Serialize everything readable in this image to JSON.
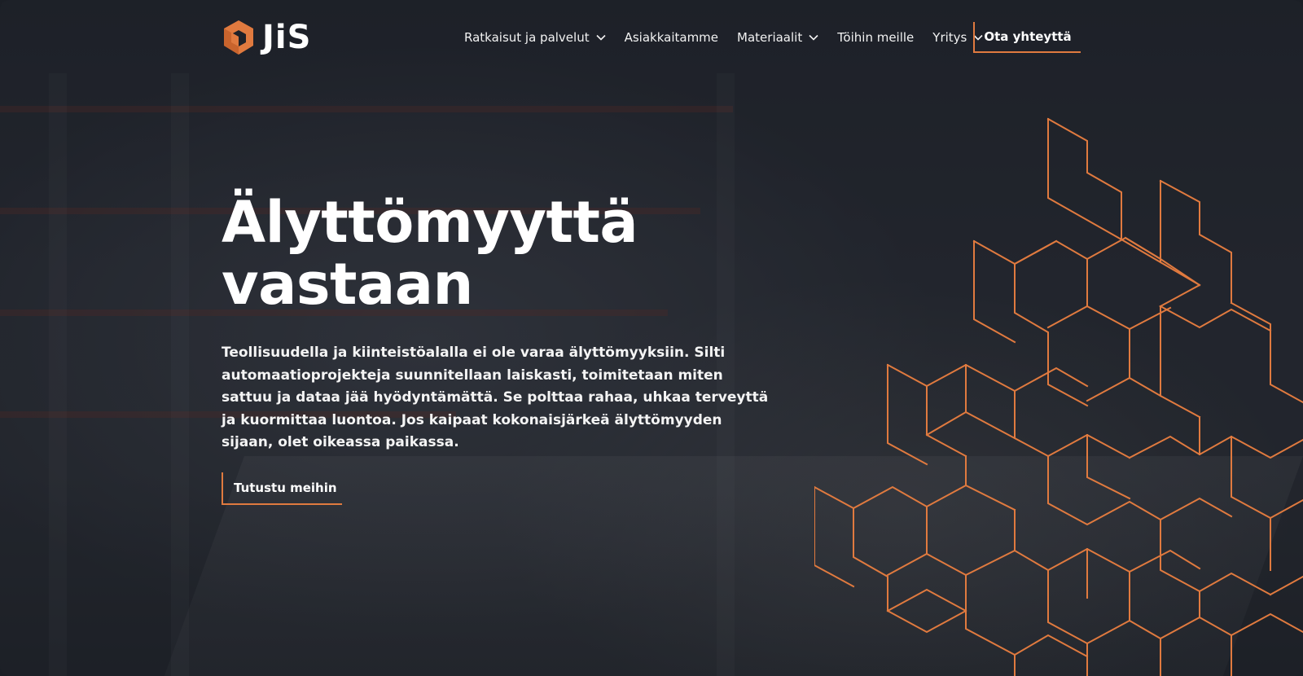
{
  "brand": {
    "logo_text": "JiS",
    "accent_color": "#e07a3f"
  },
  "nav": {
    "items": [
      {
        "label": "Ratkaisut ja palvelut",
        "has_dropdown": true
      },
      {
        "label": "Asiakkaitamme",
        "has_dropdown": false
      },
      {
        "label": "Materiaalit",
        "has_dropdown": true
      },
      {
        "label": "Töihin meille",
        "has_dropdown": false
      },
      {
        "label": "Yritys",
        "has_dropdown": true
      }
    ],
    "cta_label": "Ota yhteyttä"
  },
  "hero": {
    "title_line1": "Älyttömyyttä",
    "title_line2": "vastaan",
    "body": "Teollisuudella ja kiinteistöalalla ei ole varaa älyttömyyksiin. Silti automaatioprojekteja suunnitellaan laiskasti, toimitetaan miten sattuu ja dataa jää hyödyntämättä. Se polttaa rahaa, uhkaa terveyttä ja kuormittaa luontoa. Jos kaipaat kokonaisjärkeä älyttömyyden sijaan, olet oikeassa paikassa.",
    "button_label": "Tutustu meihin"
  },
  "icons": {
    "logo": "hexagon-cube-icon",
    "dropdown": "chevron-down-icon",
    "decoration": "isometric-line-pattern"
  }
}
